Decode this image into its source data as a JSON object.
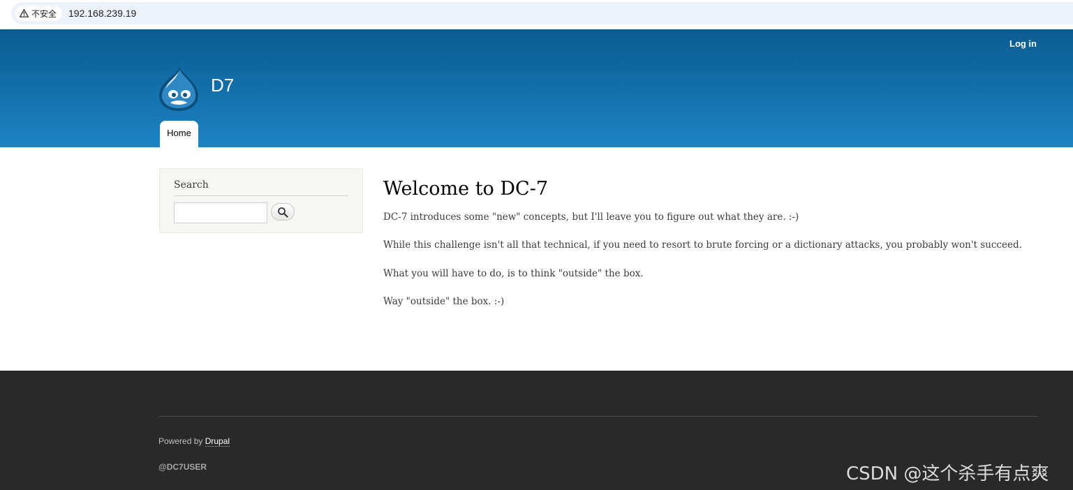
{
  "browser": {
    "security_label": "不安全",
    "url": "192.168.239.19",
    "icons": {
      "security": "warning-triangle-icon"
    }
  },
  "header": {
    "login_label": "Log in",
    "site_name": "D7",
    "logo": "drupal-drop-logo",
    "nav_tabs": [
      {
        "label": "Home",
        "active": true
      }
    ]
  },
  "sidebar": {
    "search_title": "Search",
    "search_value": "",
    "search_icon": "magnifier-icon"
  },
  "main": {
    "title": "Welcome to DC-7",
    "paragraphs": [
      "DC-7 introduces some \"new\" concepts, but I'll leave you to figure out what they are.  :-)",
      "While this challenge isn't all that technical, if you need to resort to brute forcing or a dictionary attacks, you probably won't succeed.",
      "What you will have to do, is to think \"outside\" the box.",
      "Way \"outside\" the box.  :-)"
    ]
  },
  "footer": {
    "powered_prefix": "Powered by ",
    "powered_link": "Drupal",
    "handle": "@DC7USER"
  },
  "watermark": "CSDN @这个杀手有点爽",
  "colors": {
    "header_top": "#0a5b91",
    "header_bottom": "#1d84c3",
    "footer_bg": "#292929",
    "sidebar_bg": "#f6f6f2"
  }
}
